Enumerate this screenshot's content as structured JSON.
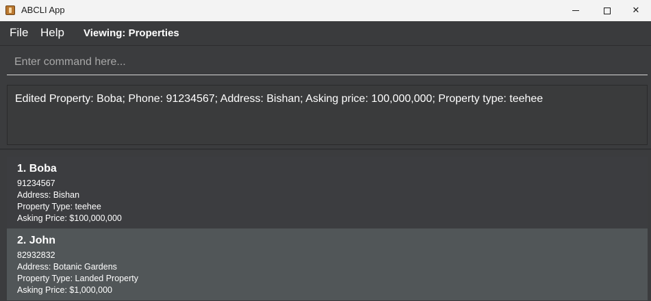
{
  "window": {
    "title": "ABCLI App",
    "controls": [
      "minimize",
      "maximize",
      "close"
    ],
    "close_symbol": "✕"
  },
  "menubar": {
    "items": [
      {
        "label": "File"
      },
      {
        "label": "Help"
      }
    ],
    "viewing": "Viewing: Properties"
  },
  "command": {
    "placeholder": "Enter command here...",
    "value": ""
  },
  "result": {
    "text": "Edited Property: Boba; Phone: 91234567; Address: Bishan; Asking price: 100,000,000; Property type: teehee"
  },
  "properties": [
    {
      "title": "1. Boba",
      "phone": "91234567",
      "address": "Address: Bishan",
      "type": "Property Type: teehee",
      "price": "Asking Price: $100,000,000"
    },
    {
      "title": "2. John",
      "phone": "82932832",
      "address": "Address: Botanic Gardens",
      "type": "Property Type: Landed Property",
      "price": "Asking Price: $1,000,000"
    }
  ],
  "colors": {
    "background": "#3b3c3e",
    "card_default": "#3c3d40",
    "card_selected": "#515658",
    "titlebar": "#f3f3f3"
  }
}
